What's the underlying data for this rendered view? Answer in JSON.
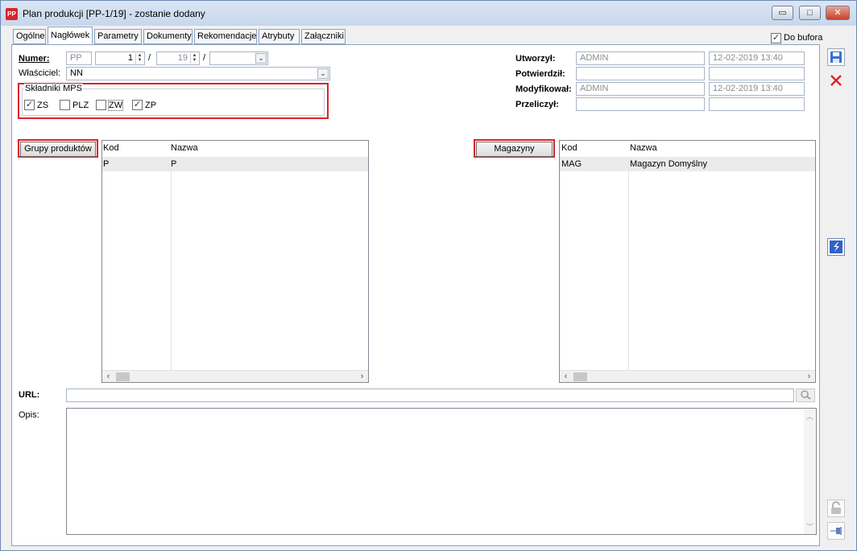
{
  "window": {
    "app_icon": "PP",
    "title": "Plan produkcji [PP-1/19] - zostanie dodany",
    "buttons": {
      "minimize": "▭",
      "maximize": "□",
      "close": "✕"
    }
  },
  "tabs": [
    "Ogólne",
    "Nagłówek",
    "Parametry",
    "Dokumenty",
    "Rekomendacje",
    "Atrybuty",
    "Załączniki"
  ],
  "active_tab": "Nagłówek",
  "do_bufora": {
    "label": "Do bufora",
    "checked": true
  },
  "numer": {
    "label": "Numer:",
    "prefix": "PP",
    "number": "1",
    "separator1": "/",
    "year": "19",
    "separator2": "/",
    "series": ""
  },
  "wlasciciel": {
    "label": "Właściciel:",
    "value": "NN"
  },
  "mps": {
    "legend": "Składniki MPS",
    "items": [
      {
        "label": "ZS",
        "checked": true
      },
      {
        "label": "PLZ",
        "checked": false
      },
      {
        "label": "ZW",
        "checked": false
      },
      {
        "label": "ZP",
        "checked": true
      }
    ]
  },
  "audit": {
    "utworzyl": {
      "label": "Utworzył:",
      "user": "ADMIN",
      "date": "12-02-2019 13:40"
    },
    "potwierdzil": {
      "label": "Potwierdził:",
      "user": "",
      "date": ""
    },
    "modyfikowal": {
      "label": "Modyfikował:",
      "user": "ADMIN",
      "date": "12-02-2019 13:40"
    },
    "przeliczyl": {
      "label": "Przeliczył:",
      "user": "",
      "date": ""
    }
  },
  "grupy": {
    "button": "Grupy produktów",
    "columns": [
      "Kod",
      "Nazwa"
    ],
    "rows": [
      {
        "kod": "P",
        "nazwa": "P"
      }
    ]
  },
  "magazyny": {
    "button": "Magazyny",
    "columns": [
      "Kod",
      "Nazwa"
    ],
    "rows": [
      {
        "kod": "MAG",
        "nazwa": "Magazyn Domyślny"
      }
    ]
  },
  "url": {
    "label": "URL:",
    "value": ""
  },
  "opis": {
    "label": "Opis:",
    "value": ""
  },
  "side_icons": [
    "save-icon",
    "cancel-icon",
    "lightning-icon",
    "lock-icon",
    "pin-icon"
  ]
}
